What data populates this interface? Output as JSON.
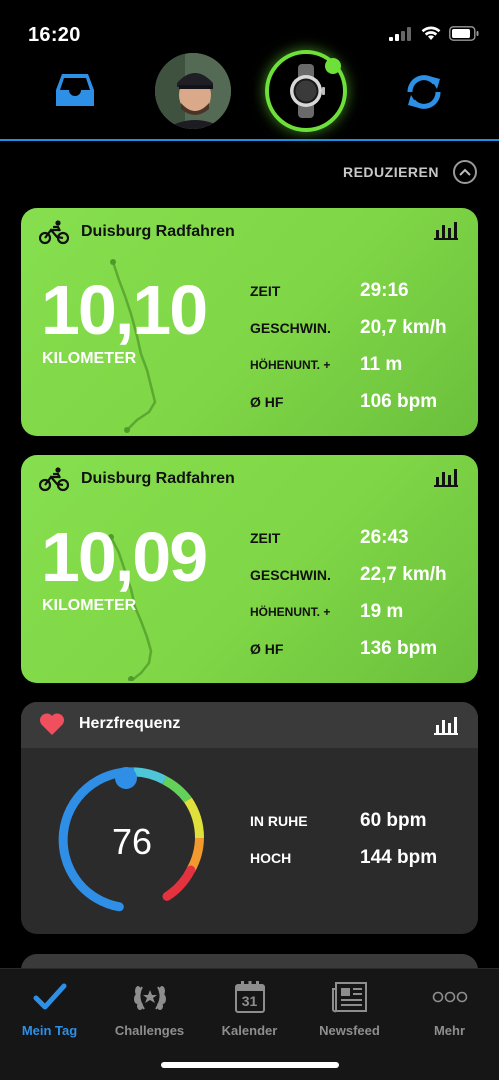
{
  "status": {
    "time": "16:20"
  },
  "header": {
    "inbox_icon": "inbox-tray-icon",
    "device_icon": "smartwatch-icon",
    "sync_icon": "sync-icon",
    "accent_color": "#2d8fe6",
    "device_ring_color": "#6ee03a"
  },
  "collapse": {
    "label": "REDUZIEREN"
  },
  "activities": [
    {
      "title": "Duisburg Radfahren",
      "value": "10,10",
      "unit": "KILOMETER",
      "stats": [
        {
          "label": "ZEIT",
          "value": "29:16"
        },
        {
          "label": "GESCHWIN.",
          "value": "20,7 km/h"
        },
        {
          "label": "HÖHENUNT. +",
          "value": "11 m"
        },
        {
          "label": "Ø HF",
          "value": "106 bpm"
        }
      ]
    },
    {
      "title": "Duisburg Radfahren",
      "value": "10,09",
      "unit": "KILOMETER",
      "stats": [
        {
          "label": "ZEIT",
          "value": "26:43"
        },
        {
          "label": "GESCHWIN.",
          "value": "22,7 km/h"
        },
        {
          "label": "HÖHENUNT. +",
          "value": "19 m"
        },
        {
          "label": "Ø HF",
          "value": "136 bpm"
        }
      ]
    }
  ],
  "heart_rate": {
    "title": "Herzfrequenz",
    "current": "76",
    "stats": [
      {
        "label": "IN RUHE",
        "value": "60 bpm"
      },
      {
        "label": "HOCH",
        "value": "144 bpm"
      }
    ]
  },
  "tabs": [
    {
      "label": "Mein Tag",
      "icon": "checkmark-icon",
      "active": true
    },
    {
      "label": "Challenges",
      "icon": "laurel-icon",
      "active": false
    },
    {
      "label": "Kalender",
      "icon": "calendar-icon",
      "calendar_day": "31",
      "active": false
    },
    {
      "label": "Newsfeed",
      "icon": "newspaper-icon",
      "active": false
    },
    {
      "label": "Mehr",
      "icon": "more-dots-icon",
      "active": false
    }
  ]
}
